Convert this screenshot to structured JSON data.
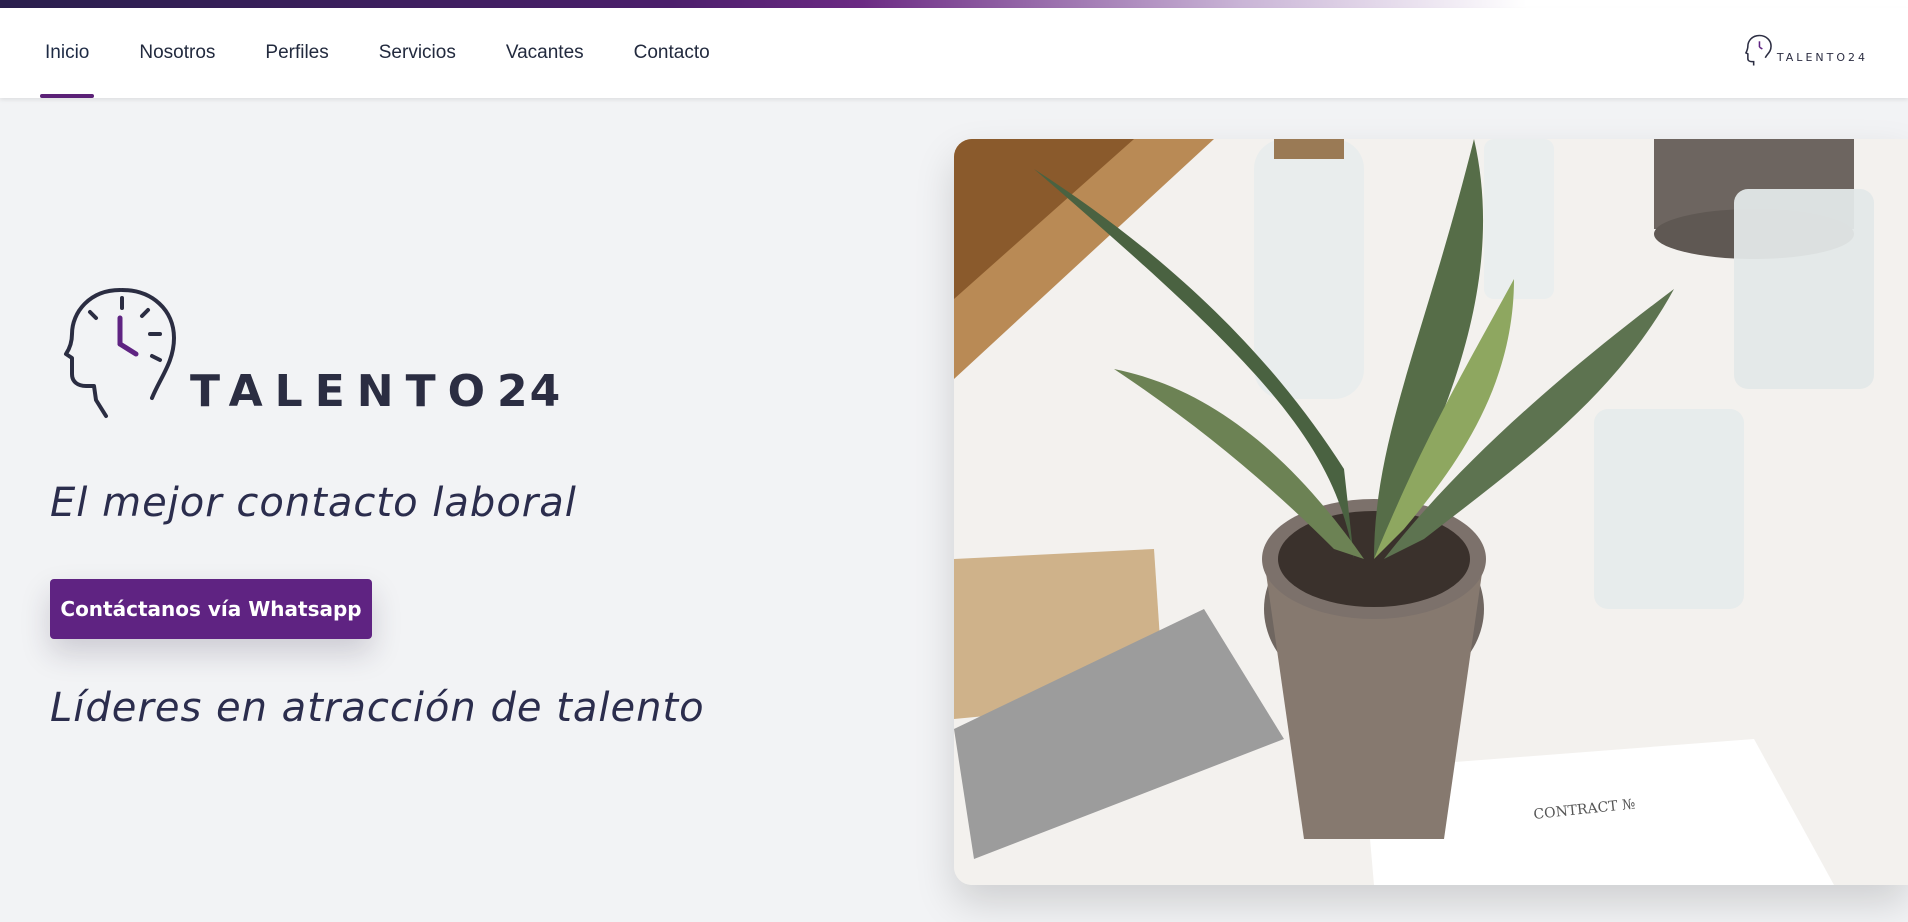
{
  "nav": {
    "items": [
      {
        "label": "Inicio",
        "active": true
      },
      {
        "label": "Nosotros",
        "active": false
      },
      {
        "label": "Perfiles",
        "active": false
      },
      {
        "label": "Servicios",
        "active": false
      },
      {
        "label": "Vacantes",
        "active": false
      },
      {
        "label": "Contacto",
        "active": false
      }
    ]
  },
  "header_logo": {
    "text": "TALENTO24",
    "icon": "head-clock-icon"
  },
  "hero": {
    "brand_word": "TALENTO",
    "brand_num": "24",
    "tagline": "El mejor contacto laboral",
    "cta_label": "Contáctanos vía Whatsapp",
    "subline": "Líderes en atracción de talento"
  },
  "photo": {
    "contract_title": "CONTRACT №"
  },
  "colors": {
    "accent": "#5f2382",
    "text_dark": "#2b2d42",
    "background": "#f2f3f5"
  }
}
